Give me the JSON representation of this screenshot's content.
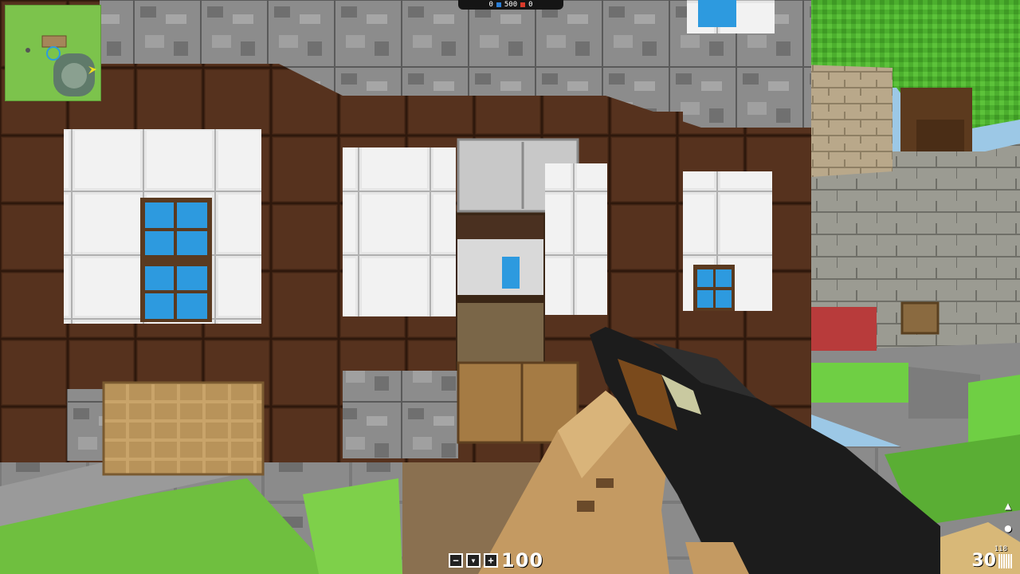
{
  "scoreboard": {
    "team_blue_score": "0",
    "target_score": "500",
    "team_red_score": "0"
  },
  "player": {
    "health": "100"
  },
  "weapon": {
    "clip_ammo": "30",
    "reserve_ammo": "118"
  },
  "icons": {
    "health_icons": [
      "armor-icon",
      "shield-icon",
      "medkit-icon"
    ],
    "side_icons": [
      "bullet-icon",
      "grenade-icon"
    ]
  },
  "colors": {
    "blue_team": "#2a7fd8",
    "red_team": "#d83a2a",
    "grass": "#6abf3a"
  }
}
